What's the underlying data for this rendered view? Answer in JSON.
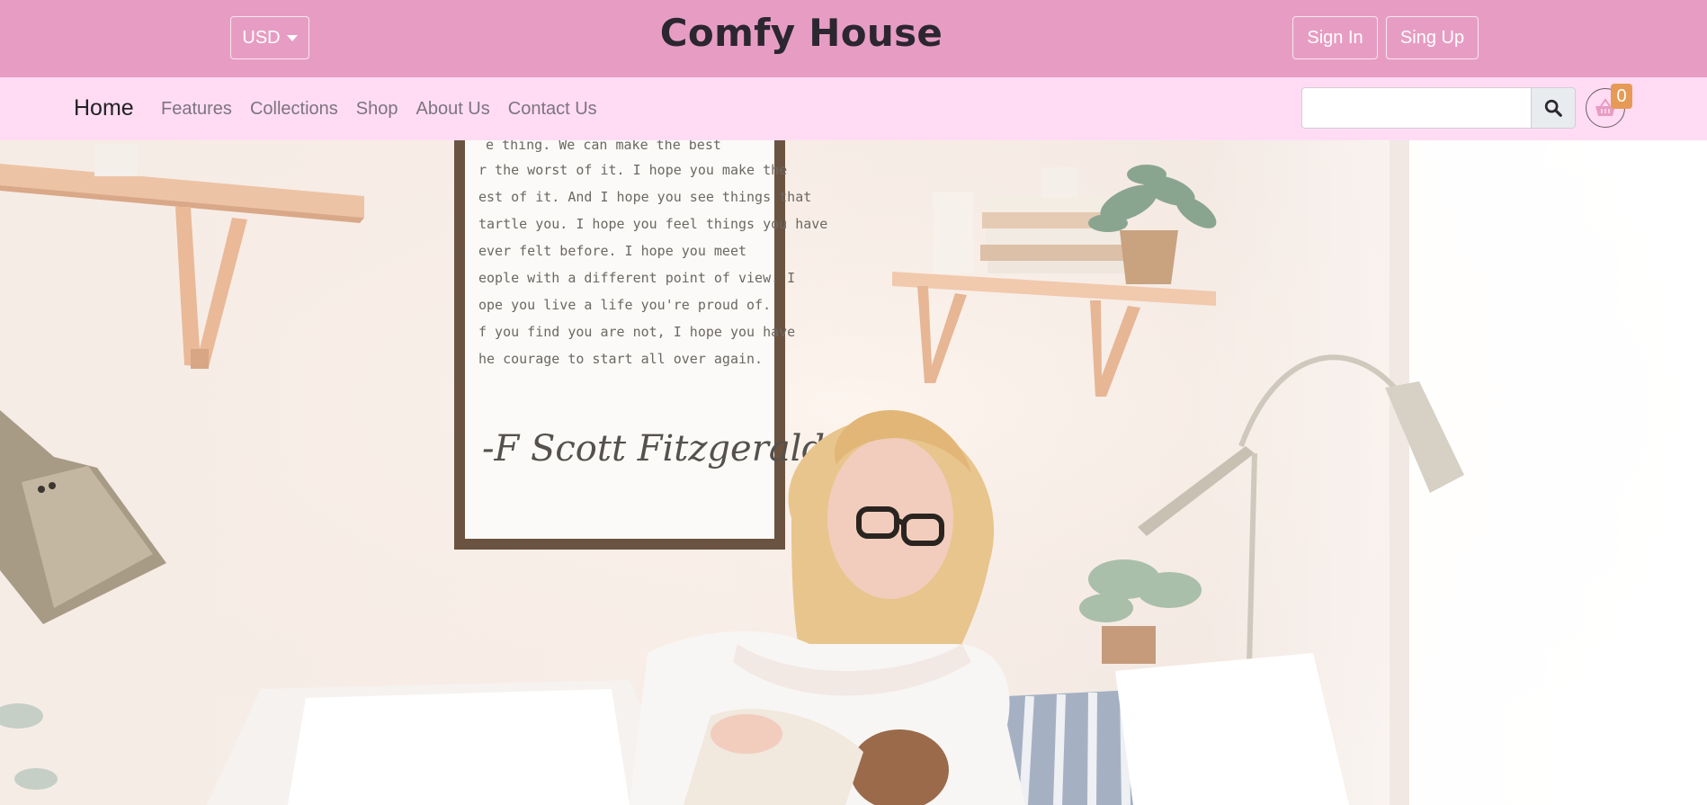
{
  "header": {
    "currency": "USD",
    "brand": "Comfy House",
    "sign_in": "Sign In",
    "sign_up": "Sing Up"
  },
  "nav": {
    "home": "Home",
    "links": [
      "Features",
      "Collections",
      "Shop",
      "About Us",
      "Contact Us"
    ]
  },
  "search": {
    "placeholder": "",
    "value": ""
  },
  "cart": {
    "count": "0"
  },
  "hero": {
    "poster_lines": [
      "e thing. We can make the best",
      "r the worst of it. I hope you make the",
      "est of it. And I hope you see things that",
      "tartle you. I hope you feel things you have",
      "ever felt before. I hope you meet",
      "eople with a different point of view. I",
      "ope you live a life you're proud of.",
      "f you find you are not, I hope you have",
      "he courage to start all over again."
    ],
    "poster_signature": "-F Scott Fitzgerald"
  },
  "colors": {
    "topbar": "#e79dc3",
    "navbar": "#ffdcf4",
    "badge": "#e69a55",
    "text_dark": "#2b2630"
  }
}
